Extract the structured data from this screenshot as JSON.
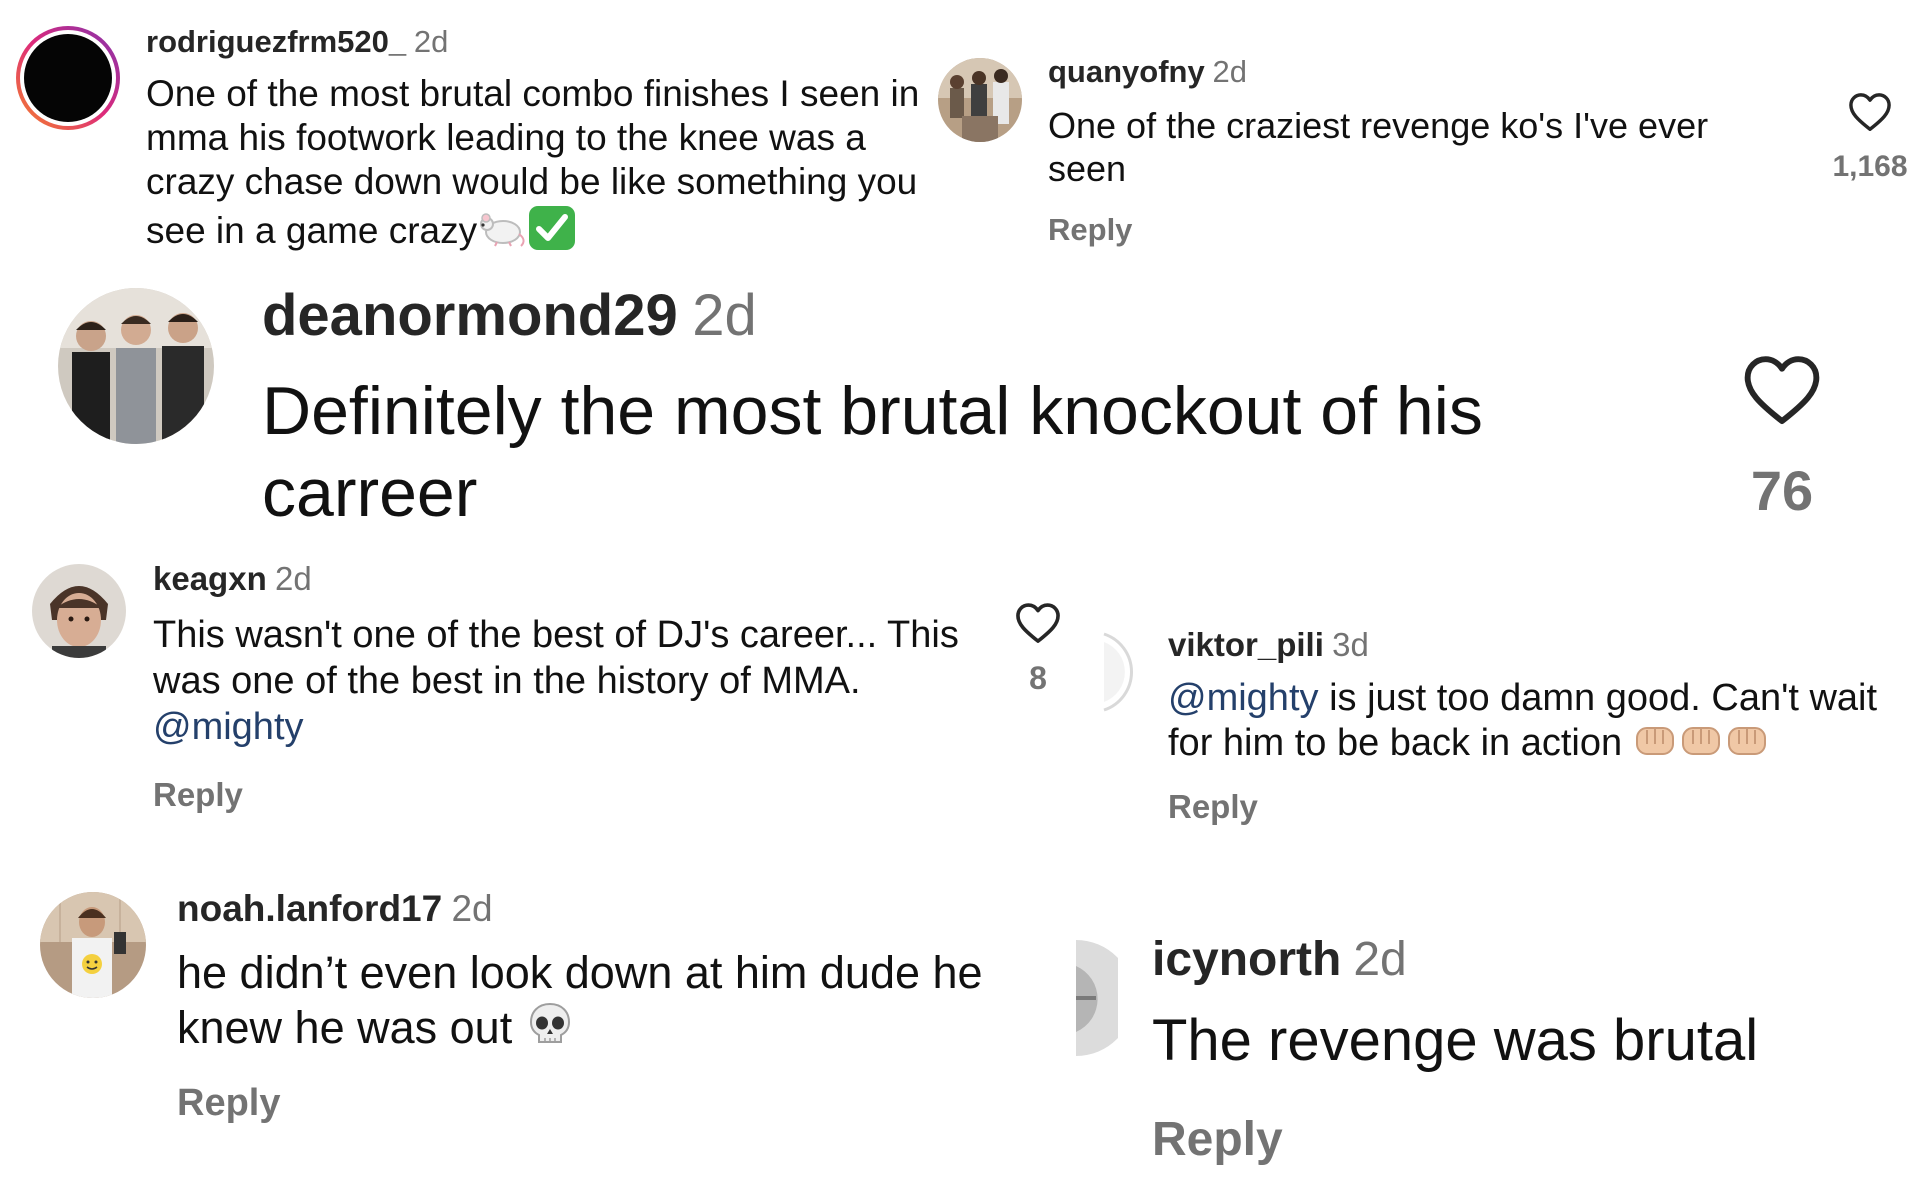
{
  "comments": [
    {
      "username": "rodriguezfrm520_",
      "time": "2d",
      "text": "One of the most brutal combo finishes I seen in mma his footwork leading to the knee was a crazy chase down would be like something you see in a game crazy",
      "avatar_icon": "story-ring-avatar-icon"
    },
    {
      "username": "quanyofny",
      "time": "2d",
      "text": "One of the craziest revenge ko's I've ever seen",
      "reply": "Reply",
      "likes": "1,168",
      "avatar_icon": "group-photo-avatar-icon"
    },
    {
      "username": "deanormond29",
      "time": "2d",
      "text": "Definitely the most brutal knockout of his carreer",
      "likes": "76",
      "avatar_icon": "three-men-photo-avatar-icon"
    },
    {
      "username": "keagxn",
      "time": "2d",
      "text_before": "This wasn't one of the best of DJ's career... This was one of the best in the history of MMA.",
      "mention": "@mighty",
      "reply": "Reply",
      "likes": "8",
      "avatar_icon": "selfie-avatar-icon"
    },
    {
      "username": "viktor_pili",
      "time": "3d",
      "mention": "@mighty",
      "text_after": "is just too damn good. Can't wait for him to be back in action",
      "reply": "Reply",
      "avatar_icon": "partial-avatar-icon"
    },
    {
      "username": "noah.lanford17",
      "time": "2d",
      "text": "he didn’t even look down at him dude he knew he was out",
      "reply": "Reply",
      "avatar_icon": "mirror-selfie-avatar-icon"
    },
    {
      "username": "icynorth",
      "time": "2d",
      "text": "The revenge was brutal",
      "reply": "Reply",
      "avatar_icon": "partial-avatar-icon"
    }
  ],
  "colors": {
    "username": "#262626",
    "secondary": "#737373",
    "mention": "#24406b",
    "story_ring_start": "#f58529",
    "story_ring_end": "#c13584"
  }
}
